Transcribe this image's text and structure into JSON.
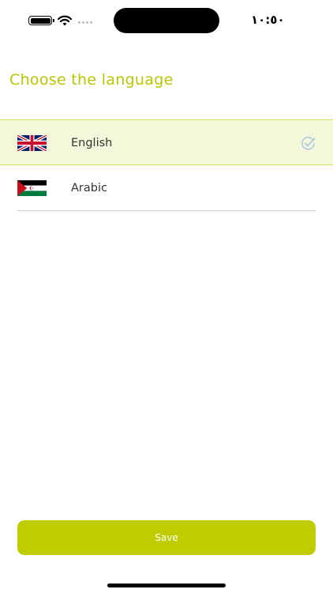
{
  "status_bar": {
    "time": "١٠:٥٠",
    "icons": [
      "battery-icon",
      "wifi-icon",
      "cellular-signal-icon"
    ]
  },
  "page": {
    "title": "Choose the language"
  },
  "languages": [
    {
      "label": "English",
      "flag": "uk-flag-icon",
      "selected": true
    },
    {
      "label": "Arabic",
      "flag": "arabic-flag-icon",
      "selected": false
    }
  ],
  "actions": {
    "save_label": "Save"
  },
  "colors": {
    "accent": "#bfcd00",
    "title": "#b9c700",
    "selected_row_bg": "#f5f7da",
    "selected_row_border": "#d4dd62",
    "check": "#a9c8e2"
  }
}
